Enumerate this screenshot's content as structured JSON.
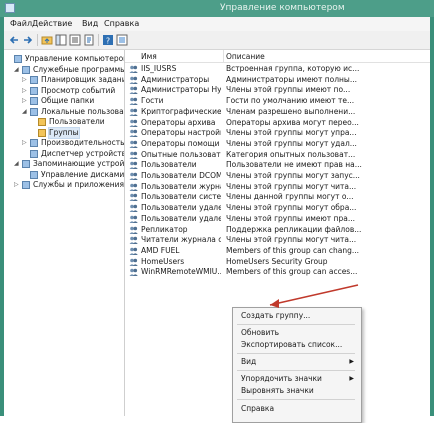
{
  "window": {
    "title": "Управление компьютером"
  },
  "menu": [
    "Файл",
    "Действие",
    "Вид",
    "Справка"
  ],
  "tree": [
    {
      "label": "Управление компьютером (л",
      "exp": "",
      "level": 0
    },
    {
      "label": "Служебные программы",
      "exp": "◢",
      "level": 1
    },
    {
      "label": "Планировщик заданий",
      "exp": "▷",
      "level": 2
    },
    {
      "label": "Просмотр событий",
      "exp": "▷",
      "level": 2
    },
    {
      "label": "Общие папки",
      "exp": "▷",
      "level": 2
    },
    {
      "label": "Локальные пользовател",
      "exp": "◢",
      "level": 2
    },
    {
      "label": "Пользователи",
      "exp": "",
      "level": 3
    },
    {
      "label": "Группы",
      "exp": "",
      "level": 3,
      "selected": true
    },
    {
      "label": "Производительность",
      "exp": "▷",
      "level": 2
    },
    {
      "label": "Диспетчер устройств",
      "exp": "",
      "level": 2
    },
    {
      "label": "Запоминающие устройства",
      "exp": "◢",
      "level": 1
    },
    {
      "label": "Управление дисками",
      "exp": "",
      "level": 2
    },
    {
      "label": "Службы и приложения",
      "exp": "▷",
      "level": 1
    }
  ],
  "columns": {
    "name": "Имя",
    "description": "Описание"
  },
  "groups": [
    {
      "name": "IIS_IUSRS",
      "desc": "Встроенная группа, которую ис..."
    },
    {
      "name": "Администраторы",
      "desc": "Администраторы имеют полны..."
    },
    {
      "name": "Администраторы Hy...",
      "desc": "Члены этой группы имеют по..."
    },
    {
      "name": "Гости",
      "desc": "Гости по умолчанию имеют те..."
    },
    {
      "name": "Криптографические ...",
      "desc": "Членам разрешено выполнени..."
    },
    {
      "name": "Операторы архива",
      "desc": "Операторы архива могут перео..."
    },
    {
      "name": "Операторы настройк...",
      "desc": "Члены этой группы могут упра..."
    },
    {
      "name": "Операторы помощи ...",
      "desc": "Члены этой группы могут удал..."
    },
    {
      "name": "Опытные пользовате...",
      "desc": "Категория опытных пользоват..."
    },
    {
      "name": "Пользователи",
      "desc": "Пользователи не имеют прав на..."
    },
    {
      "name": "Пользователи DCOM",
      "desc": "Члены этой группы могут запус..."
    },
    {
      "name": "Пользователи журна...",
      "desc": "Члены этой группы могут чита..."
    },
    {
      "name": "Пользователи систе...",
      "desc": "Члены данной группы могут о..."
    },
    {
      "name": "Пользователи удале...",
      "desc": "Члены этой группы могут обра..."
    },
    {
      "name": "Пользователи удале...",
      "desc": "Члены этой группы имеют пра..."
    },
    {
      "name": "Репликатор",
      "desc": "Поддержка репликации файлов..."
    },
    {
      "name": "Читатели журнала с...",
      "desc": "Члены этой группы могут чита..."
    },
    {
      "name": "AMD FUEL",
      "desc": "Members of this group can chang..."
    },
    {
      "name": "HomeUsers",
      "desc": "HomeUsers Security Group"
    },
    {
      "name": "WinRMRemoteWMIU...",
      "desc": "Members of this group can acces..."
    }
  ],
  "context_menu": {
    "create_group": "Создать группу...",
    "refresh": "Обновить",
    "export": "Экспортировать список...",
    "view": "Вид",
    "arrange": "Упорядочить значки",
    "align": "Выровнять значки",
    "help": "Справка"
  },
  "colors": {
    "titlebar": "#4d9e89",
    "arrow": "#c0392b",
    "selection": "#dbe8f6"
  }
}
